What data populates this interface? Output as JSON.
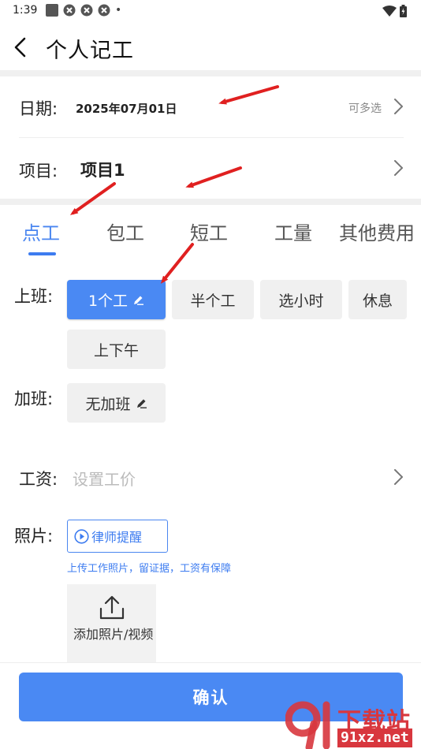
{
  "status_bar": {
    "time": "1:39",
    "dot": "•"
  },
  "header": {
    "title": "个人记工",
    "back_icon": "chevron-left-icon"
  },
  "date_row": {
    "label": "日期:",
    "value": "2025年07月01日",
    "hint": "可多选"
  },
  "project_row": {
    "label": "项目:",
    "value": "项目1"
  },
  "tabs": [
    {
      "label": "点工",
      "active": true
    },
    {
      "label": "包工",
      "active": false
    },
    {
      "label": "短工",
      "active": false
    },
    {
      "label": "工量",
      "active": false
    },
    {
      "label": "其他费用",
      "active": false
    }
  ],
  "shift": {
    "label": "上班:",
    "options": [
      {
        "label": "1个工",
        "selected": true
      },
      {
        "label": "半个工",
        "selected": false
      },
      {
        "label": "选小时",
        "selected": false
      },
      {
        "label": "休息",
        "selected": false
      },
      {
        "label": "上下午",
        "selected": false
      }
    ]
  },
  "overtime": {
    "label": "加班:",
    "value": "无加班"
  },
  "salary": {
    "label": "工资:",
    "placeholder": "设置工价"
  },
  "photo": {
    "label": "照片:",
    "lawyer_button": "律师提醒",
    "hint": "上传工作照片，留证据，工资有保障",
    "upload_label": "添加照片/视频"
  },
  "confirm_button": "确认",
  "watermark": {
    "title": "下载站",
    "url": "91xz.net"
  },
  "colors": {
    "accent": "#4a89f3",
    "link": "#3d7cf0",
    "annotation_arrow": "#e02020",
    "watermark": "#d8373e"
  }
}
